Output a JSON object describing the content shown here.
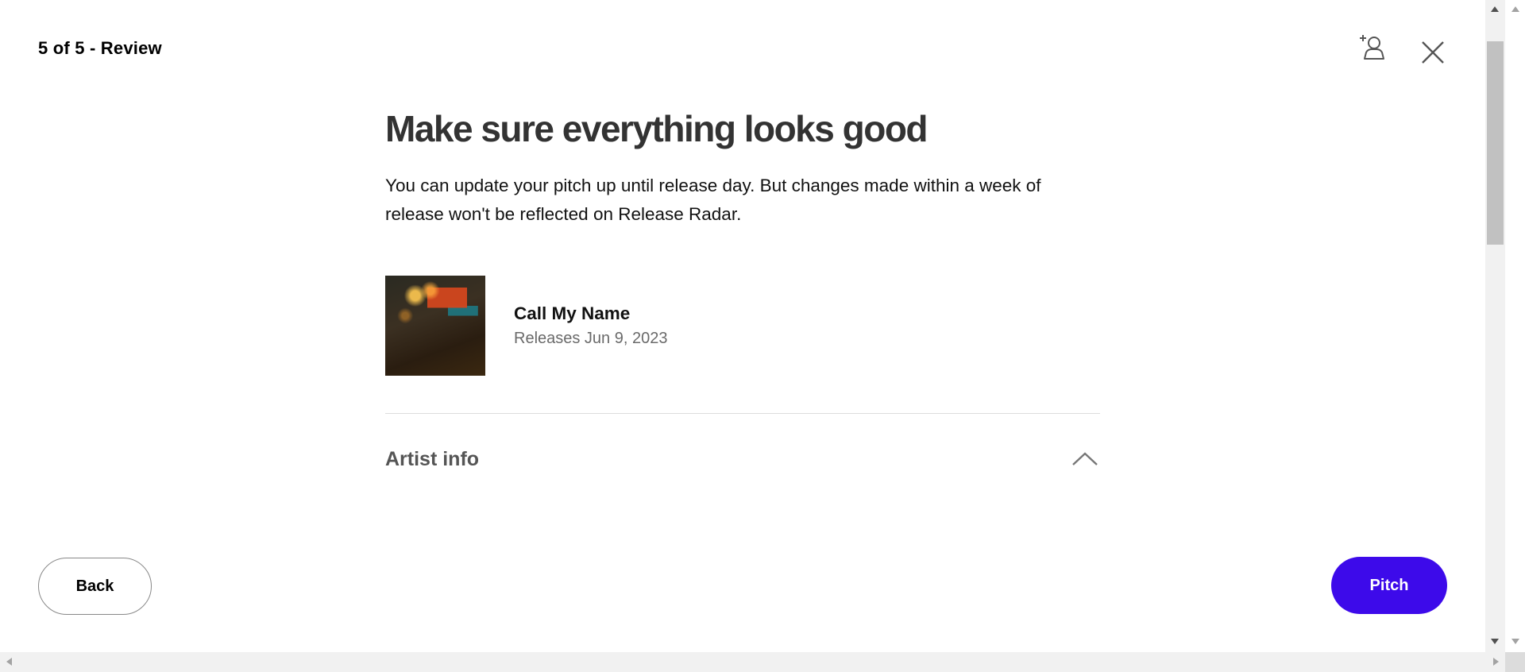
{
  "header": {
    "step_label": "5 of 5 - Review",
    "add_collaborator_icon": "add-person-icon",
    "close_icon": "close-icon"
  },
  "main": {
    "headline": "Make sure everything looks good",
    "subtext": "You can update your pitch up until release day. But changes made within a week of release won't be reflected on Release Radar.",
    "release": {
      "title": "Call My Name",
      "date": "Releases Jun 9, 2023"
    },
    "section": {
      "title": "Artist info",
      "icon": "chevron-up-icon",
      "expanded": true
    }
  },
  "footer": {
    "back_label": "Back",
    "pitch_label": "Pitch"
  },
  "colors": {
    "accent": "#3d0aea",
    "headline": "#333333",
    "muted": "#6a6a6a"
  }
}
